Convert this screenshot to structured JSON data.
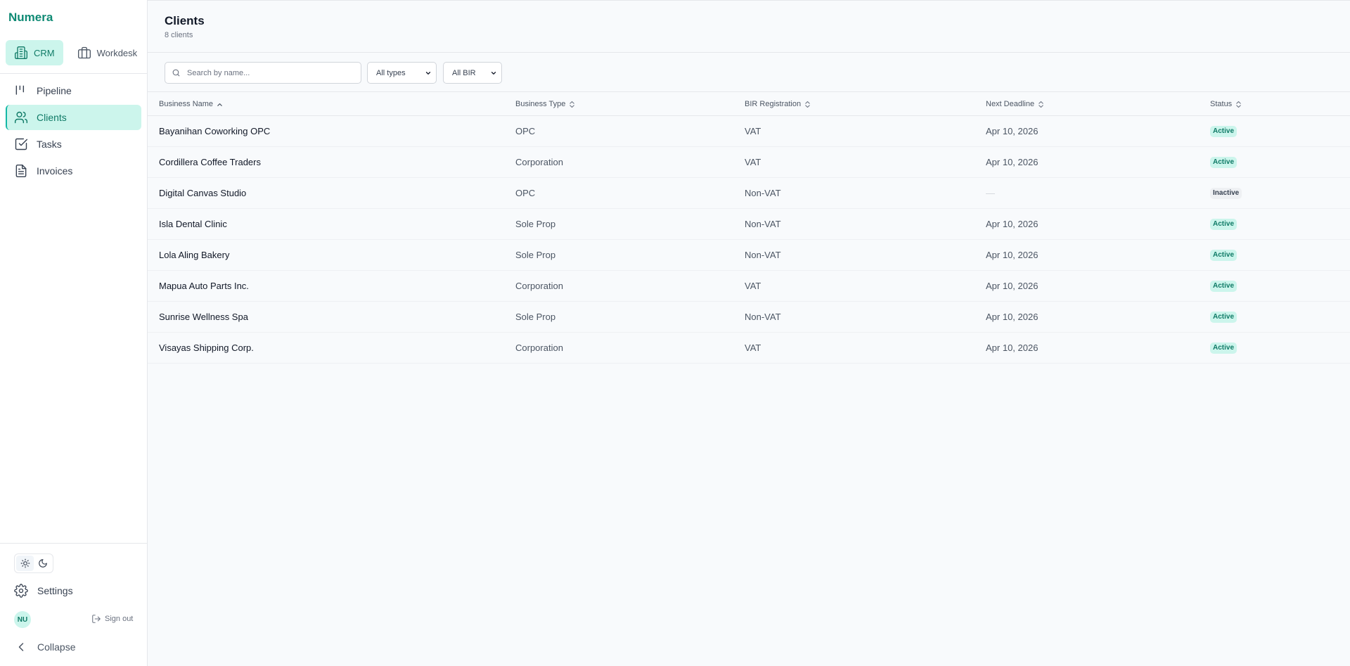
{
  "app": {
    "brand": "Numera"
  },
  "mode_switch": {
    "crm_label": "CRM",
    "workdesk_label": "Workdesk"
  },
  "nav": [
    {
      "label": "Pipeline",
      "icon": "pipeline-icon"
    },
    {
      "label": "Clients",
      "icon": "users-icon",
      "active": true
    },
    {
      "label": "Tasks",
      "icon": "check-square-icon"
    },
    {
      "label": "Invoices",
      "icon": "file-text-icon"
    }
  ],
  "footer": {
    "settings_label": "Settings",
    "avatar_initials": "NU",
    "signout_label": "Sign out",
    "collapse_label": "Collapse"
  },
  "page": {
    "title": "Clients",
    "count": "8 clients"
  },
  "filters": {
    "search_placeholder": "Search by name...",
    "type_select": "All types",
    "bir_select": "All BIR"
  },
  "table": {
    "headers": {
      "name": "Business Name",
      "type": "Business Type",
      "bir": "BIR Registration",
      "deadline": "Next Deadline",
      "status": "Status"
    },
    "sort": {
      "column": "Business Name",
      "direction": "ascending"
    },
    "rows": [
      {
        "name": "Bayanihan Coworking OPC",
        "type": "OPC",
        "bir": "VAT",
        "deadline": "Apr 10, 2026",
        "status": "Active"
      },
      {
        "name": "Cordillera Coffee Traders",
        "type": "Corporation",
        "bir": "VAT",
        "deadline": "Apr 10, 2026",
        "status": "Active"
      },
      {
        "name": "Digital Canvas Studio",
        "type": "OPC",
        "bir": "Non-VAT",
        "deadline": "—",
        "status": "Inactive"
      },
      {
        "name": "Isla Dental Clinic",
        "type": "Sole Prop",
        "bir": "Non-VAT",
        "deadline": "Apr 10, 2026",
        "status": "Active"
      },
      {
        "name": "Lola Aling Bakery",
        "type": "Sole Prop",
        "bir": "Non-VAT",
        "deadline": "Apr 10, 2026",
        "status": "Active"
      },
      {
        "name": "Mapua Auto Parts Inc.",
        "type": "Corporation",
        "bir": "VAT",
        "deadline": "Apr 10, 2026",
        "status": "Active"
      },
      {
        "name": "Sunrise Wellness Spa",
        "type": "Sole Prop",
        "bir": "Non-VAT",
        "deadline": "Apr 10, 2026",
        "status": "Active"
      },
      {
        "name": "Visayas Shipping Corp.",
        "type": "Corporation",
        "bir": "VAT",
        "deadline": "Apr 10, 2026",
        "status": "Active"
      }
    ]
  },
  "colors": {
    "accent": "#0f8a74",
    "accent_bg": "#ccf5ec",
    "background": "#f8fafc"
  }
}
